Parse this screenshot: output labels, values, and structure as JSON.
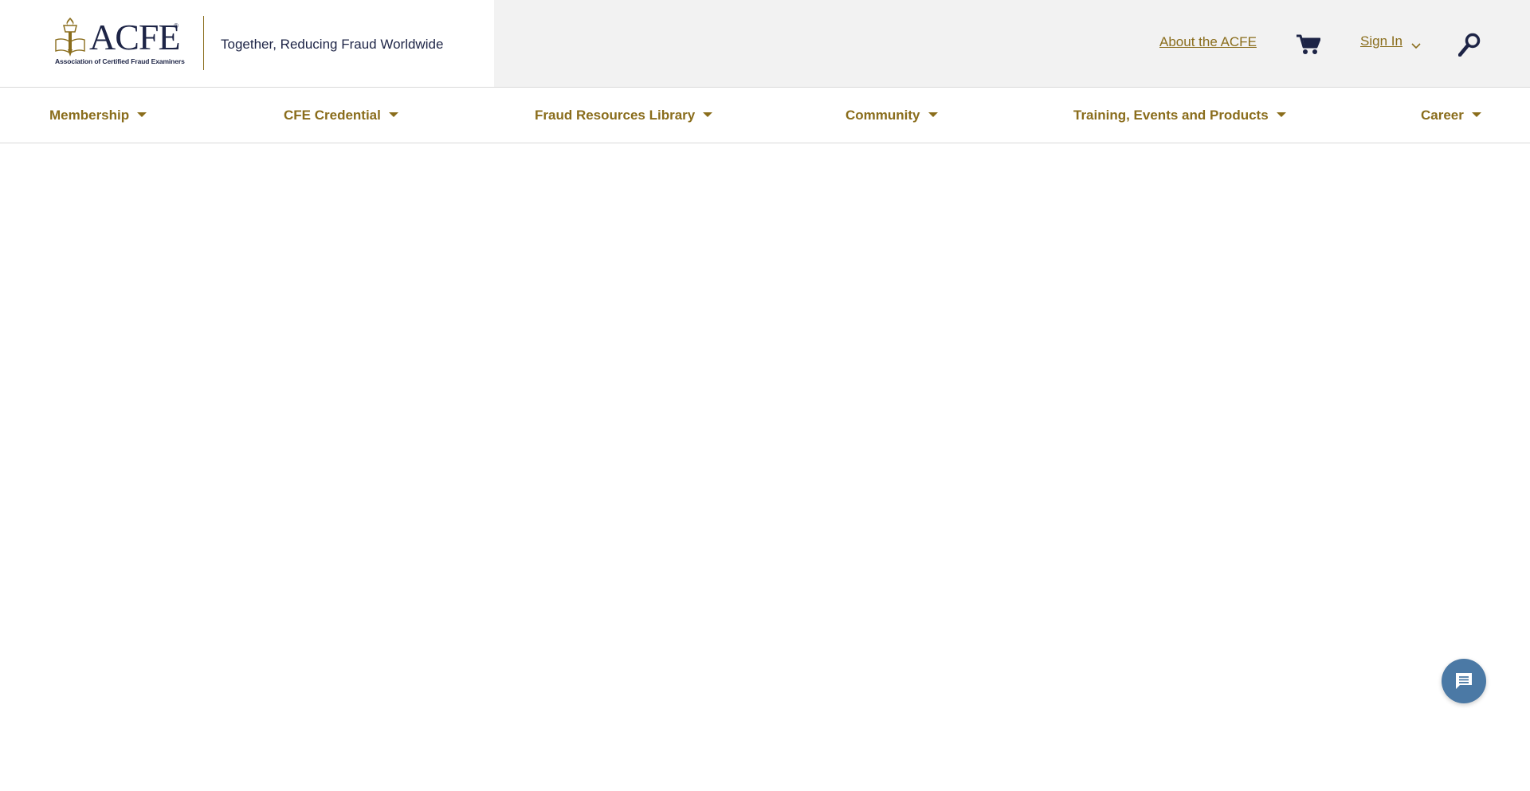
{
  "header": {
    "logo": {
      "wordmark": "ACFE",
      "subtitle": "Association of Certified Fraud Examiners",
      "registered": "®"
    },
    "tagline": "Together, Reducing Fraud Worldwide",
    "utility": {
      "about_label": "About the ACFE",
      "signin_label": "Sign In",
      "cart_icon": "cart-icon",
      "search_icon": "search-icon",
      "chevron_icon": "chevron-down-icon"
    }
  },
  "nav": {
    "items": [
      {
        "label": "Membership"
      },
      {
        "label": "CFE Credential"
      },
      {
        "label": "Fraud Resources Library"
      },
      {
        "label": "Community"
      },
      {
        "label": "Training, Events and Products"
      },
      {
        "label": "Career"
      }
    ]
  },
  "chat": {
    "icon": "chat-icon"
  },
  "colors": {
    "brand_gold": "#8a6d1c",
    "brand_navy": "#1d2446",
    "utility_bg": "#f2f2f2",
    "chat_blue": "#4b79a5"
  }
}
